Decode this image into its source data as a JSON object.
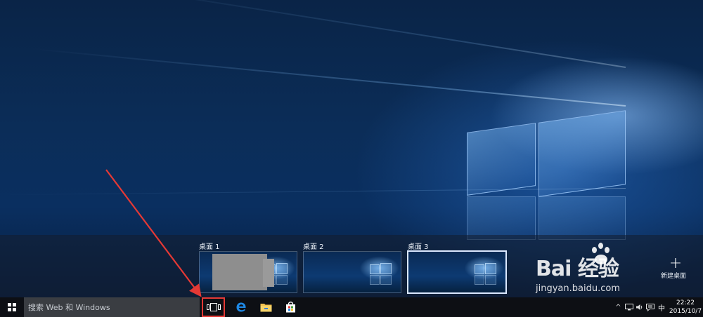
{
  "task_view": {
    "desktops": [
      {
        "label": "桌面 1",
        "active": false,
        "has_window": true
      },
      {
        "label": "桌面 2",
        "active": false,
        "has_window": false
      },
      {
        "label": "桌面 3",
        "active": true,
        "has_window": false
      }
    ],
    "new_desktop": {
      "icon": "plus-icon",
      "label": "新建桌面"
    }
  },
  "watermark": {
    "brand": "Bai  经验",
    "url": "jingyan.baidu.com"
  },
  "taskbar": {
    "start_icon": "windows-logo-icon",
    "search_placeholder": "搜索 Web 和 Windows",
    "pinned": [
      {
        "name": "task-view",
        "icon": "task-view-icon"
      },
      {
        "name": "edge",
        "icon": "edge-icon",
        "glyph": "e"
      },
      {
        "name": "file-explorer",
        "icon": "folder-icon"
      },
      {
        "name": "store",
        "icon": "store-icon"
      }
    ],
    "tray": {
      "chevron": "^",
      "ime": "中",
      "time": "22:22",
      "date": "2015/10/7"
    }
  },
  "colors": {
    "highlight_box": "#e53935",
    "arrow": "#e53935",
    "taskbar_bg": "#0d0f14",
    "edge_blue": "#1e88e5",
    "folder_yellow": "#f2c14e"
  }
}
